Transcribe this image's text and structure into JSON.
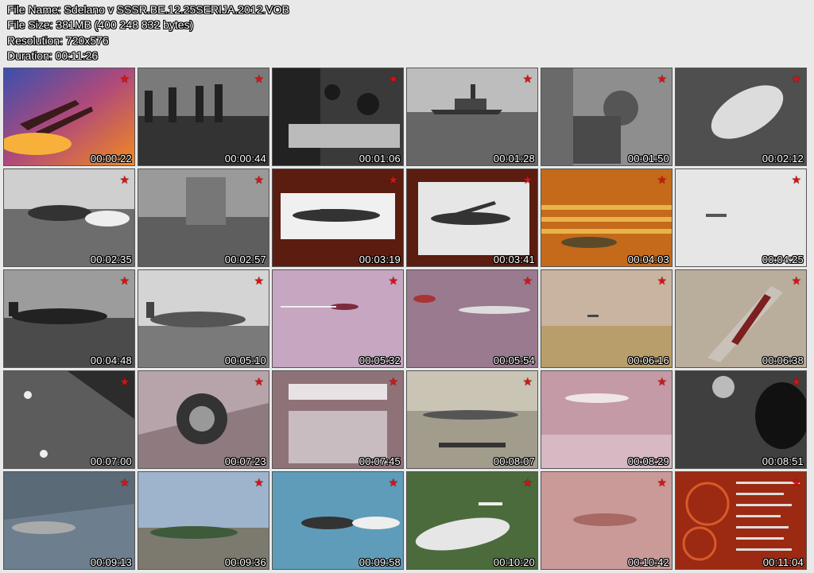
{
  "header": {
    "file_name": "File Name: Sdelano v SSSR.BE.12.25SERIJA.2012.VOB",
    "file_size": "File Size: 381MB (400 248 832 bytes)",
    "resolution": "Resolution: 720x576",
    "duration": "Duration: 00:11:26"
  },
  "thumbnails": [
    {
      "time": "00:00:22",
      "bg": "#7a3f7a"
    },
    {
      "time": "00:00:44",
      "bg": "#555555"
    },
    {
      "time": "00:01:06",
      "bg": "#3c3c3c"
    },
    {
      "time": "00:01:28",
      "bg": "#8d8d8d"
    },
    {
      "time": "00:01:50",
      "bg": "#9a9a9a"
    },
    {
      "time": "00:02:12",
      "bg": "#5f5f5f"
    },
    {
      "time": "00:02:35",
      "bg": "#8a8a8a"
    },
    {
      "time": "00:02:57",
      "bg": "#7a7a7a"
    },
    {
      "time": "00:03:19",
      "bg": "#5a1d10"
    },
    {
      "time": "00:03:41",
      "bg": "#5a1d10"
    },
    {
      "time": "00:04:03",
      "bg": "#c4741c"
    },
    {
      "time": "00:04:25",
      "bg": "#e4e4e4"
    },
    {
      "time": "00:04:48",
      "bg": "#6e6e6e"
    },
    {
      "time": "00:05:10",
      "bg": "#9b9b9b"
    },
    {
      "time": "00:05:32",
      "bg": "#c7a7c0"
    },
    {
      "time": "00:05:54",
      "bg": "#9a7a8e"
    },
    {
      "time": "00:06:16",
      "bg": "#b9a48f"
    },
    {
      "time": "00:06:38",
      "bg": "#b2a89a"
    },
    {
      "time": "00:07:00",
      "bg": "#5f5f5f"
    },
    {
      "time": "00:07:23",
      "bg": "#8f7a80"
    },
    {
      "time": "00:07:45",
      "bg": "#8f7278"
    },
    {
      "time": "00:08:07",
      "bg": "#a4a092"
    },
    {
      "time": "00:08:29",
      "bg": "#c19aa6"
    },
    {
      "time": "00:08:51",
      "bg": "#3f3f3f"
    },
    {
      "time": "00:09:13",
      "bg": "#5c7080"
    },
    {
      "time": "00:09:36",
      "bg": "#8fa4bd"
    },
    {
      "time": "00:09:58",
      "bg": "#5f9cb9"
    },
    {
      "time": "00:10:20",
      "bg": "#4b6b3c"
    },
    {
      "time": "00:10:42",
      "bg": "#c99a98"
    },
    {
      "time": "00:11:04",
      "bg": "#9c2a12"
    }
  ],
  "icons": {
    "corner_star": "red-star-icon",
    "star_color": "#d21515"
  }
}
